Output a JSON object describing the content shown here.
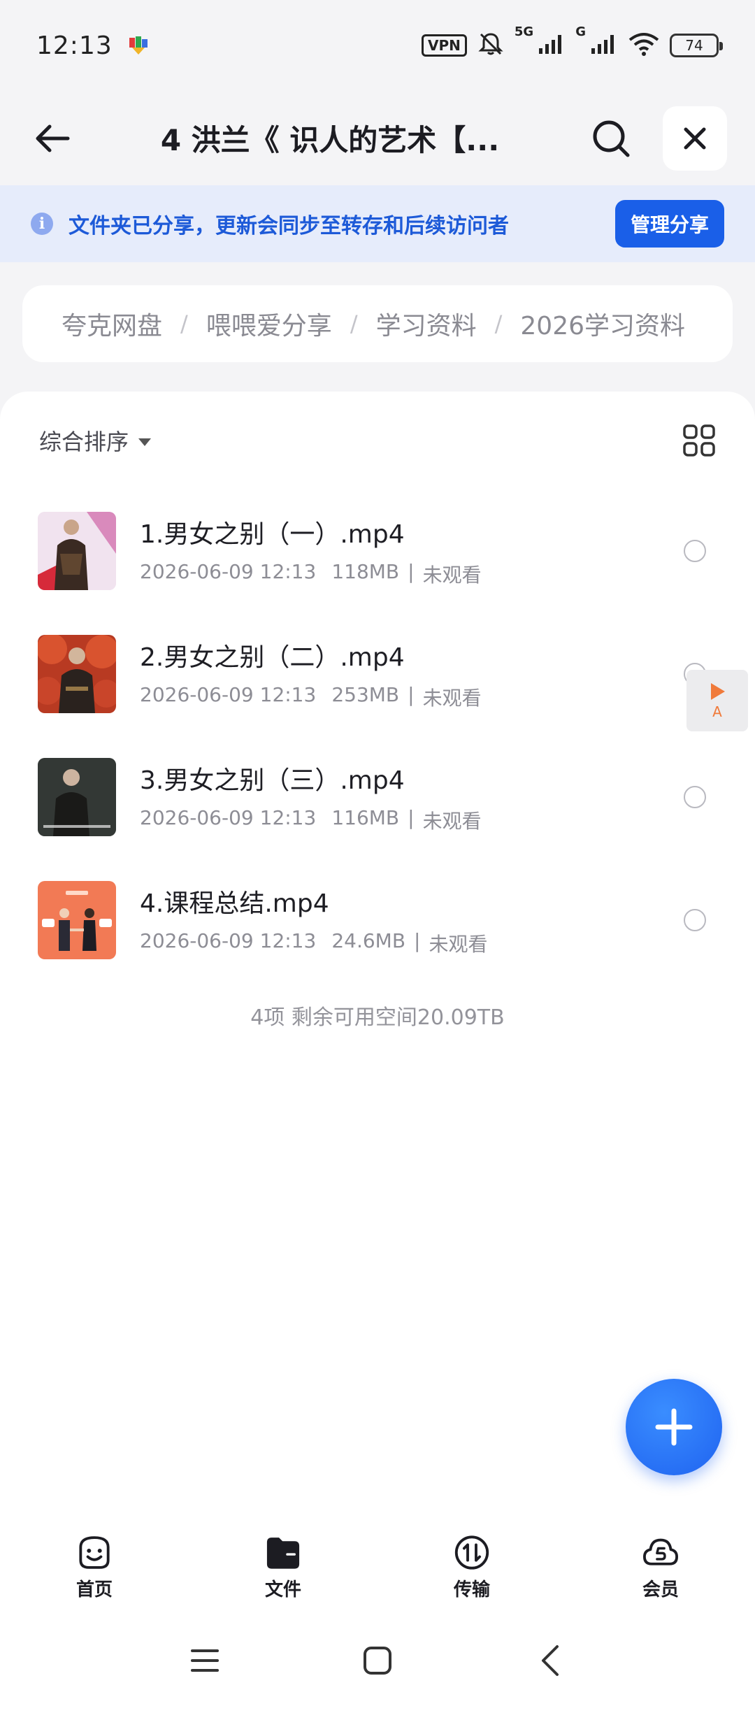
{
  "status_bar": {
    "time": "12:13",
    "vpn": "VPN",
    "network_1": "5G",
    "network_2": "G",
    "battery": "74"
  },
  "header": {
    "title": "4 洪兰《 识人的艺术【..."
  },
  "share_banner": {
    "text": "文件夹已分享，更新会同步至转存和后续访问者",
    "button": "管理分享",
    "info_glyph": "i"
  },
  "breadcrumb": {
    "items": [
      "夸克网盘",
      "喂喂爱分享",
      "学习资料",
      "2026学习资料"
    ],
    "separator": "/"
  },
  "sort": {
    "label": "综合排序"
  },
  "files": [
    {
      "name": "1.男女之别（一）.mp4",
      "date": "2026-06-09 12:13",
      "size": "118MB",
      "status": "未观看"
    },
    {
      "name": "2.男女之别（二）.mp4",
      "date": "2026-06-09 12:13",
      "size": "253MB",
      "status": "未观看"
    },
    {
      "name": "3.男女之别（三）.mp4",
      "date": "2026-06-09 12:13",
      "size": "116MB",
      "status": "未观看"
    },
    {
      "name": "4.课程总结.mp4",
      "date": "2026-06-09 12:13",
      "size": "24.6MB",
      "status": "未观看"
    }
  ],
  "meta_separator": "|",
  "summary": "4项 剩余可用空间20.09TB",
  "side_widget": {
    "letter": "A"
  },
  "bottom_nav": [
    {
      "label": "首页",
      "icon": "smile-face-icon"
    },
    {
      "label": "文件",
      "icon": "folder-icon"
    },
    {
      "label": "传输",
      "icon": "transfer-icon"
    },
    {
      "label": "会员",
      "icon": "cloud-member-icon"
    }
  ],
  "colors": {
    "accent": "#1a5fe8",
    "banner_bg": "#e6ecfb",
    "banner_text": "#1d5ad8",
    "page_bg": "#f4f4f6"
  }
}
